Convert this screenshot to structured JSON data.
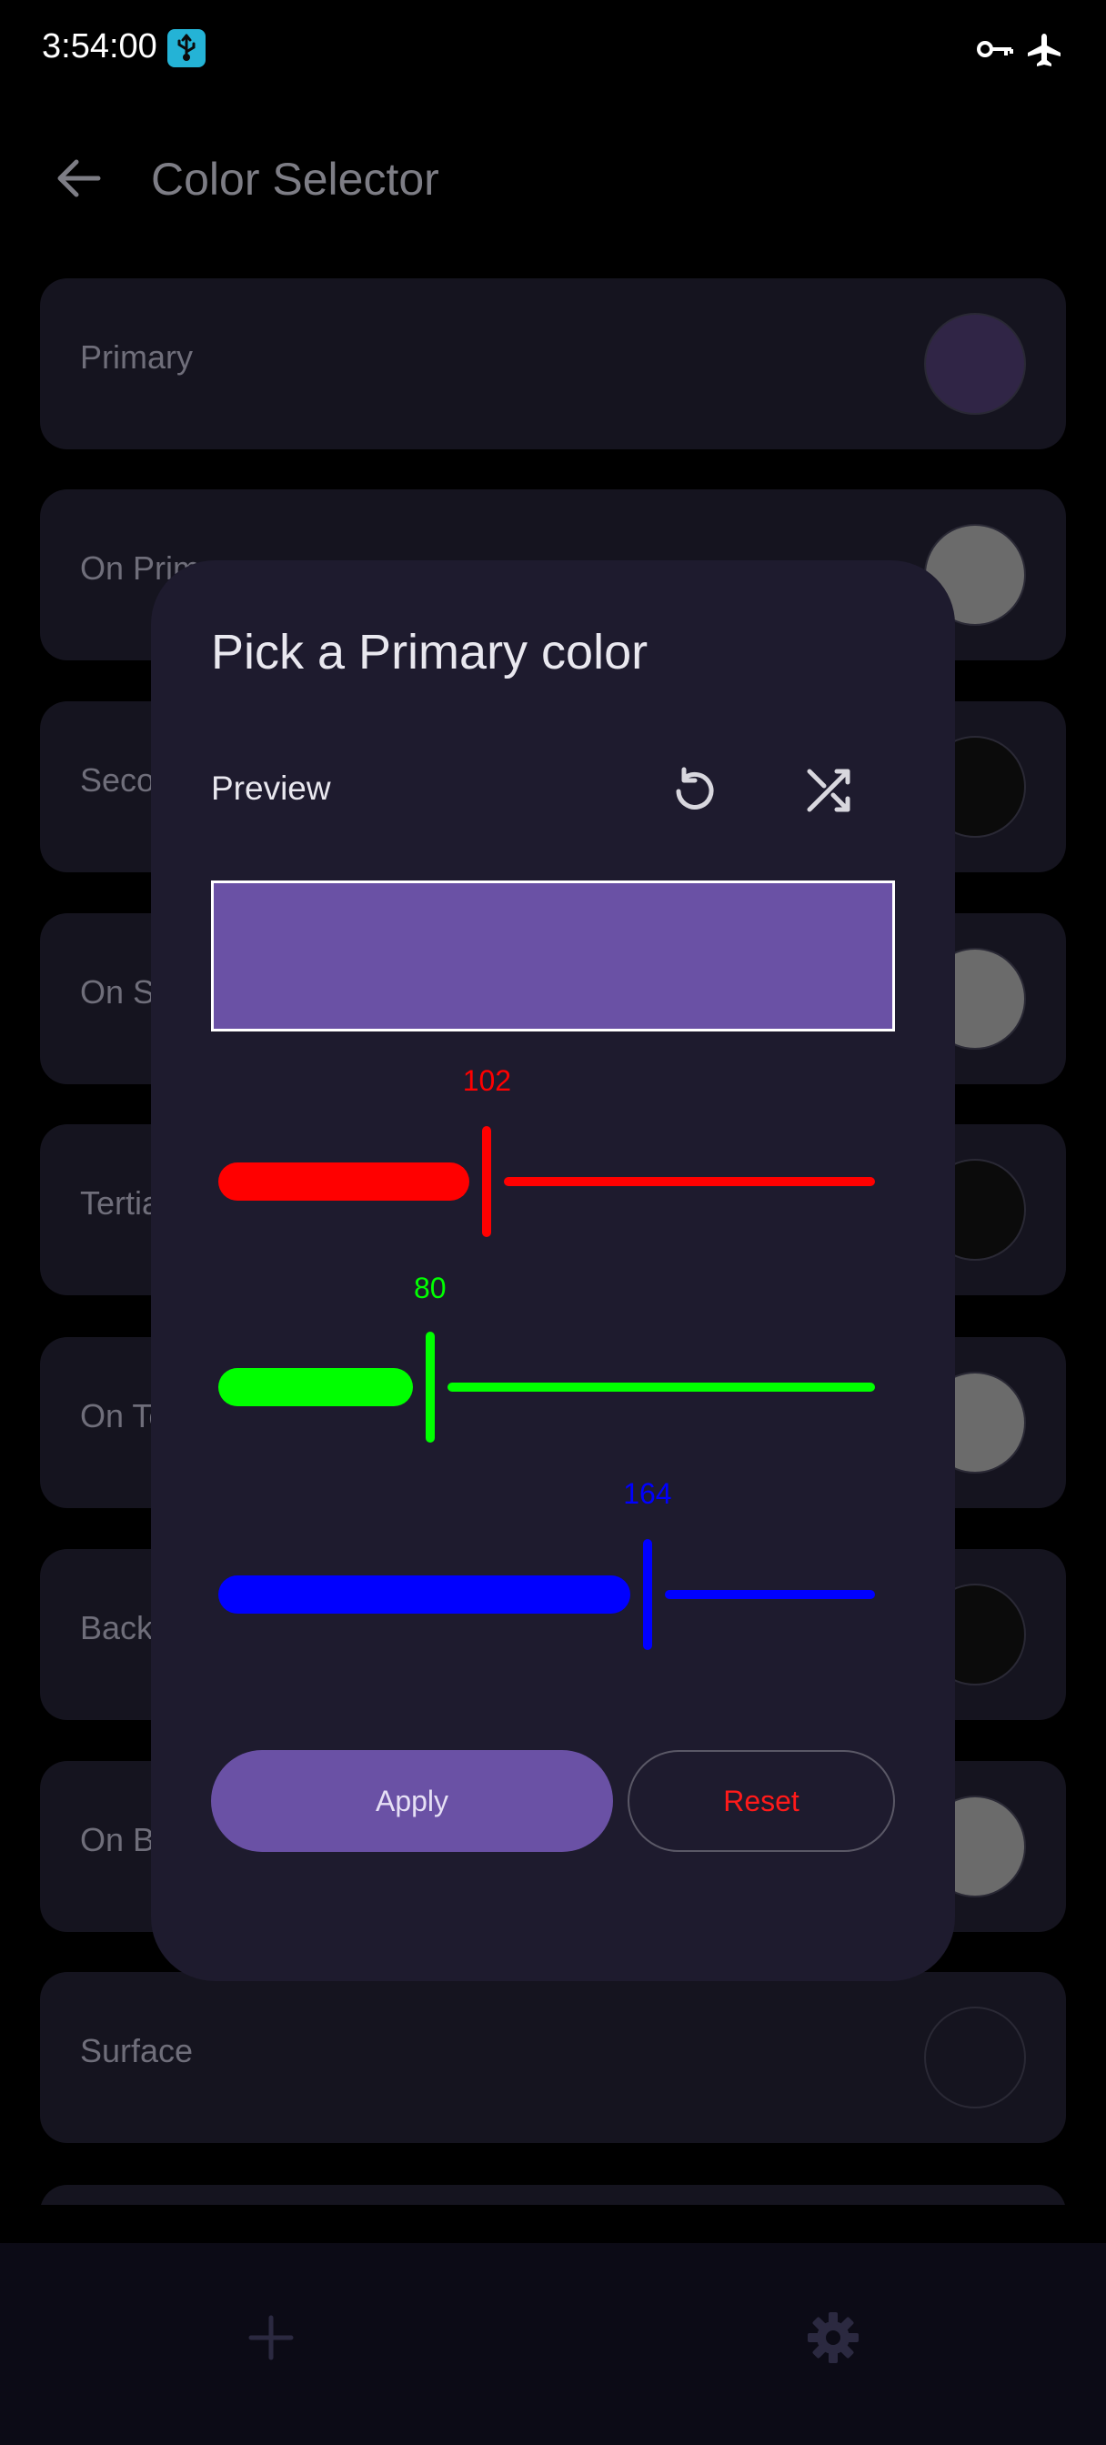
{
  "status_bar": {
    "time": "3:54:00",
    "icons": [
      "usb-debug-icon",
      "vpn-key-icon",
      "airplane-icon"
    ]
  },
  "app_bar": {
    "title": "Color Selector",
    "back_icon": "arrow-back-icon"
  },
  "color_list": [
    {
      "label": "Primary",
      "swatch": "#302546"
    },
    {
      "label": "On Primary",
      "swatch": "#6b6b6b"
    },
    {
      "label": "Secondary",
      "swatch": "#0b0b0b"
    },
    {
      "label": "On Secondary",
      "swatch": "#6b6b6b"
    },
    {
      "label": "Tertiary",
      "swatch": "#0b0b0b"
    },
    {
      "label": "On Tertiary",
      "swatch": "#6b6b6b"
    },
    {
      "label": "Background",
      "swatch": "#0b0b0b"
    },
    {
      "label": "On Background",
      "swatch": "#6b6b6b"
    },
    {
      "label": "Surface",
      "swatch": "#15141f"
    },
    {
      "label": "",
      "swatch": "#15141f"
    }
  ],
  "dialog": {
    "title": "Pick a Primary color",
    "preview_label": "Preview",
    "undo_icon": "undo-icon",
    "shuffle_icon": "shuffle-icon",
    "preview_color": "#6a51a5",
    "sliders": [
      {
        "name": "red",
        "value": 102,
        "value_label": "102",
        "max": 255,
        "color": "#ff0000"
      },
      {
        "name": "green",
        "value": 80,
        "value_label": "80",
        "max": 255,
        "color": "#00ff00"
      },
      {
        "name": "blue",
        "value": 164,
        "value_label": "164",
        "max": 255,
        "color": "#0000ff"
      }
    ],
    "apply_label": "Apply",
    "reset_label": "Reset"
  },
  "bottom_bar": {
    "icons": [
      "add-icon",
      "settings-icon"
    ]
  },
  "colors": {
    "accent": "#6a51a5",
    "dialog_bg": "#1e1b2e",
    "reset_text": "#ff1a1a"
  }
}
